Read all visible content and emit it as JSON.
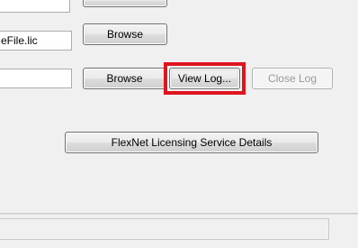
{
  "license_file_field": {
    "value": "eFile.lic",
    "browse_label": "Browse"
  },
  "log_file_field": {
    "value": "",
    "browse_label": "Browse"
  },
  "buttons": {
    "view_log": "View Log...",
    "close_log": "Close Log",
    "service_details": "FlexNet Licensing Service Details"
  },
  "colors": {
    "highlight": "#e0141e",
    "window_bg": "#f0f0f0",
    "disabled_text": "#9a9a9a"
  }
}
